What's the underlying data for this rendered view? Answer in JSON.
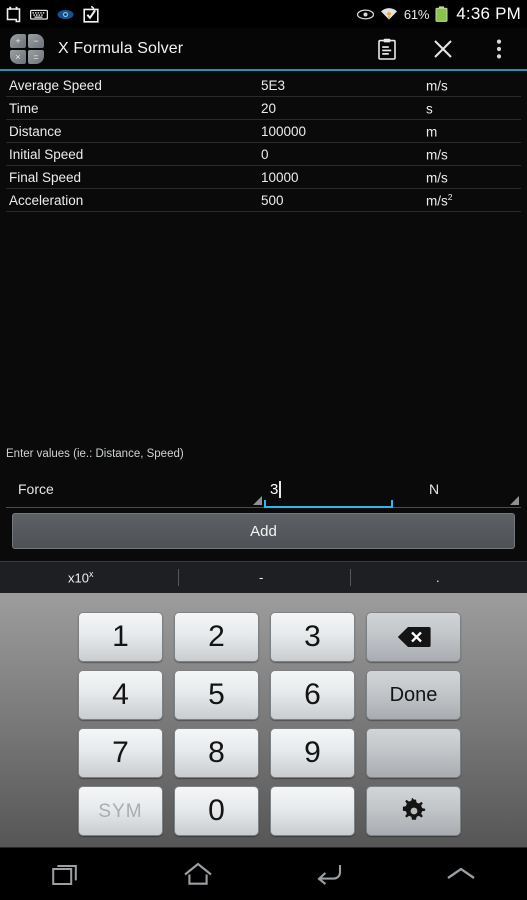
{
  "status_bar": {
    "icons_left": [
      "clipboard-icon",
      "keyboard-icon",
      "eye-icon",
      "checkbox-bag-icon"
    ],
    "eye_icon": "eye-icon",
    "wifi_icon": "wifi-icon",
    "battery_percent": "61%",
    "battery_icon": "battery-icon",
    "time": "4:36 PM"
  },
  "action_bar": {
    "app_icon": "calculator-icon",
    "icon_glyphs": [
      "+",
      "−",
      "×",
      "="
    ],
    "title": "X Formula Solver",
    "actions": [
      {
        "name": "clipboard-button",
        "icon": "clipboard-icon"
      },
      {
        "name": "close-button",
        "icon": "close-icon"
      },
      {
        "name": "overflow-button",
        "icon": "overflow-menu-icon"
      }
    ]
  },
  "results_table": {
    "rows": [
      {
        "name": "Average Speed",
        "value": "5E3",
        "unit": "m/s",
        "unit_sup": ""
      },
      {
        "name": "Time",
        "value": "20",
        "unit": "s",
        "unit_sup": ""
      },
      {
        "name": "Distance",
        "value": "100000",
        "unit": "m",
        "unit_sup": ""
      },
      {
        "name": "Initial Speed",
        "value": "0",
        "unit": "m/s",
        "unit_sup": ""
      },
      {
        "name": "Final Speed",
        "value": "10000",
        "unit": "m/s",
        "unit_sup": ""
      },
      {
        "name": "Acceleration",
        "value": "500",
        "unit": "m/s",
        "unit_sup": "2"
      }
    ]
  },
  "input_area": {
    "hint": "Enter values (ie.: Distance, Speed)",
    "quantity_spinner": {
      "selected": "Force"
    },
    "value_field": {
      "value": "3",
      "placeholder": ""
    },
    "unit_spinner": {
      "selected": "N"
    },
    "add_button": "Add"
  },
  "keyboard": {
    "suggestions": [
      {
        "label": "x10",
        "sup": "x"
      },
      {
        "label": "-",
        "sup": ""
      },
      {
        "label": ".",
        "sup": ""
      }
    ],
    "keys": [
      {
        "label": "1",
        "name": "key-1",
        "style": "light"
      },
      {
        "label": "2",
        "name": "key-2",
        "style": "light"
      },
      {
        "label": "3",
        "name": "key-3",
        "style": "light"
      },
      {
        "label": "",
        "name": "key-backspace",
        "style": "dark",
        "icon": "backspace-icon"
      },
      {
        "label": "4",
        "name": "key-4",
        "style": "light"
      },
      {
        "label": "5",
        "name": "key-5",
        "style": "light"
      },
      {
        "label": "6",
        "name": "key-6",
        "style": "light"
      },
      {
        "label": "Done",
        "name": "key-done",
        "style": "dark"
      },
      {
        "label": "7",
        "name": "key-7",
        "style": "light"
      },
      {
        "label": "8",
        "name": "key-8",
        "style": "light"
      },
      {
        "label": "9",
        "name": "key-9",
        "style": "light"
      },
      {
        "label": "",
        "name": "key-blank-right",
        "style": "dark"
      },
      {
        "label": "SYM",
        "name": "key-sym",
        "style": "light"
      },
      {
        "label": "0",
        "name": "key-0",
        "style": "light"
      },
      {
        "label": "",
        "name": "key-space",
        "style": "light"
      },
      {
        "label": "",
        "name": "key-settings",
        "style": "dark",
        "icon": "gear-icon"
      }
    ]
  },
  "nav_bar": {
    "buttons": [
      {
        "name": "recents-button",
        "icon": "recents-icon"
      },
      {
        "name": "home-button",
        "icon": "home-icon"
      },
      {
        "name": "back-button",
        "icon": "back-icon"
      },
      {
        "name": "hide-keyboard-button",
        "icon": "chevron-up-icon"
      }
    ]
  },
  "colors": {
    "accent": "#33b5e5",
    "background": "#0a0a0a",
    "battery_green": "#8bc34a"
  }
}
